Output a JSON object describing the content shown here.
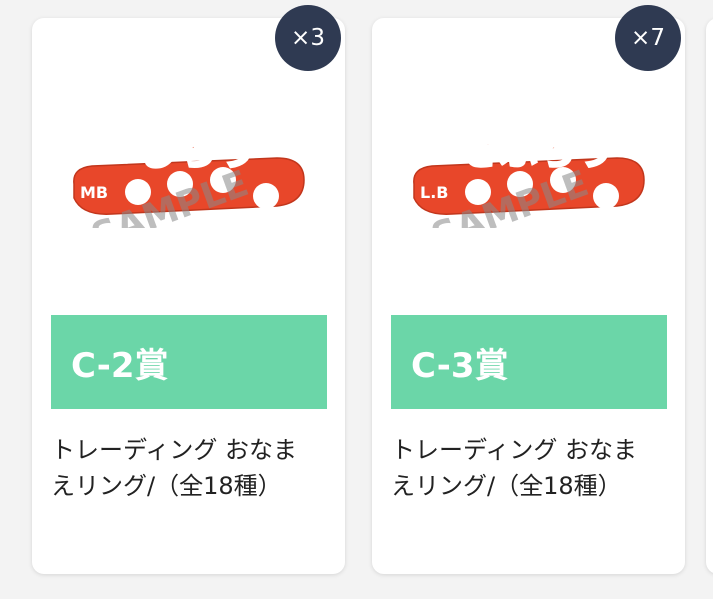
{
  "cards": [
    {
      "badge": "×3",
      "art_text": "じろう",
      "art_tag": "MB",
      "watermark": "SAMPLE",
      "prize": "C-2賞",
      "title": "トレーディング おなまえリング/（全18種）",
      "art_color": "#e8472a"
    },
    {
      "badge": "×7",
      "art_text": "さぶろう",
      "art_tag": "L.B",
      "watermark": "SAMPLE",
      "prize": "C-3賞",
      "title": "トレーディング おなまえリング/（全18種）",
      "art_color": "#e8472a"
    }
  ],
  "colors": {
    "badge_bg": "#2f3a52",
    "banner_bg": "#6bd6a8",
    "page_bg": "#f3f3f3"
  }
}
